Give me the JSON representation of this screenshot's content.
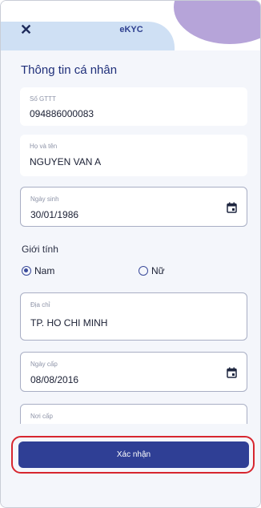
{
  "header": {
    "title": "eKYC",
    "close_icon": "close-icon"
  },
  "section": {
    "title": "Thông tin cá nhân"
  },
  "fields": {
    "id_number": {
      "label": "Số GTTT",
      "value": "094886000083"
    },
    "full_name": {
      "label": "Họ và tên",
      "value": "NGUYEN VAN A"
    },
    "dob": {
      "label": "Ngày sinh",
      "value": "30/01/1986",
      "icon": "calendar-icon"
    },
    "address": {
      "label": "Địa chỉ",
      "value": "TP. HO CHI MINH"
    },
    "issue_date": {
      "label": "Ngày cấp",
      "value": "08/08/2016",
      "icon": "calendar-icon"
    },
    "issue_place": {
      "label": "Nơi cấp",
      "value": ""
    }
  },
  "gender": {
    "label": "Giới tính",
    "options": [
      {
        "label": "Nam",
        "selected": true
      },
      {
        "label": "Nữ",
        "selected": false
      }
    ]
  },
  "confirm": {
    "label": "Xác nhận"
  },
  "colors": {
    "primary": "#2f3f95",
    "highlight": "#d7262f",
    "accent": "#b6a4d9"
  }
}
